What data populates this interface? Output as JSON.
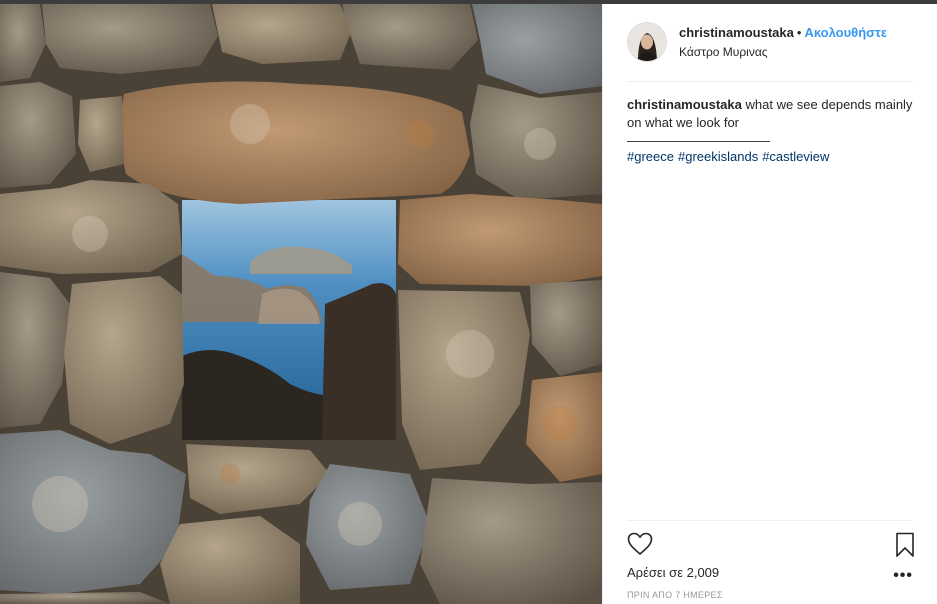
{
  "post": {
    "photo_alt": "stone wall window sea view",
    "author": {
      "username": "christinamoustaka",
      "separator": "•",
      "follow_label": "Ακολουθήστε",
      "location": "Κάστρο Μυρινας"
    },
    "caption": {
      "username": "christinamoustaka",
      "text": "what we see depends mainly on what we look for",
      "rule": "———————————"
    },
    "hashtags": [
      "#greece",
      "#greekislands",
      "#castleview"
    ],
    "actions": {
      "like_icon": "heart-outline-icon",
      "save_icon": "bookmark-outline-icon",
      "more_label": "•••"
    },
    "likes_text": "Αρέσει σε 2,009",
    "timestamp": "ΠΡΙΝ ΑΠΟ 7 ΗΜΕΡΕΣ"
  },
  "colors": {
    "link_blue": "#3897f0",
    "hashtag": "#003569",
    "text": "#262626",
    "muted": "#999999"
  }
}
